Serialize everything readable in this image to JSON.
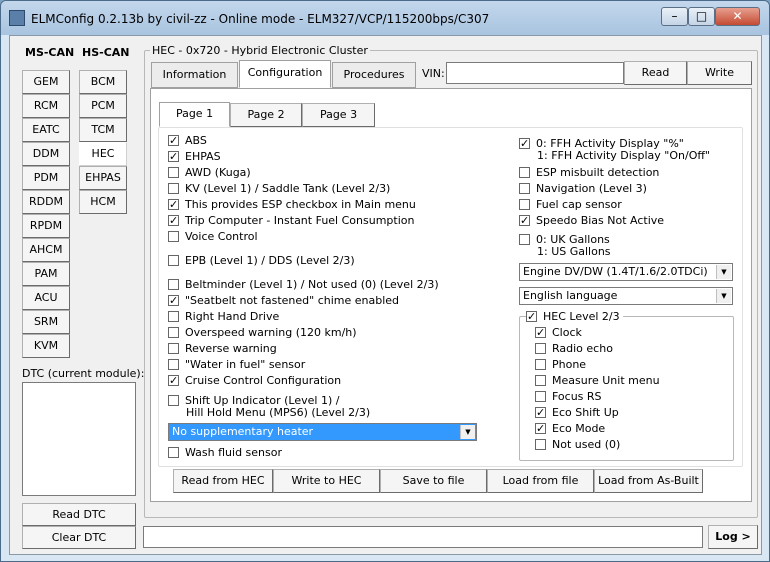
{
  "window": {
    "title": "ELMConfig 0.2.13b by civil-zz - Online mode - ELM327/VCP/115200bps/C307",
    "min_glyph": "–",
    "max_glyph": "□",
    "close_glyph": "✕"
  },
  "bus": {
    "ms_can_label": "MS-CAN",
    "hs_can_label": "HS-CAN",
    "ms_can": [
      "GEM",
      "RCM",
      "EATC",
      "DDM",
      "PDM",
      "RDDM",
      "RPDM",
      "AHCM",
      "PAM",
      "ACU",
      "SRM",
      "KVM"
    ],
    "hs_can": [
      "BCM",
      "PCM",
      "TCM",
      "HEC",
      "EHPAS",
      "HCM"
    ],
    "hs_active": "HEC"
  },
  "dtc": {
    "label": "DTC (current module):",
    "read": "Read DTC",
    "clear": "Clear DTC"
  },
  "module": {
    "group_label": "HEC - 0x720 - Hybrid Electronic Cluster",
    "tabs": [
      "Information",
      "Configuration",
      "Procedures"
    ],
    "active_tab": "Configuration",
    "vin_label": "VIN:",
    "vin_value": "",
    "read": "Read",
    "write": "Write"
  },
  "pages": [
    "Page 1",
    "Page 2",
    "Page 3"
  ],
  "active_page": "Page 1",
  "left_options": [
    {
      "label": "ABS",
      "checked": true
    },
    {
      "label": "EHPAS",
      "checked": true
    },
    {
      "label": "AWD (Kuga)",
      "checked": false
    },
    {
      "label": "KV (Level 1) / Saddle Tank (Level 2/3)",
      "checked": false
    },
    {
      "label": "This provides ESP checkbox in Main menu",
      "checked": true
    },
    {
      "label": "Trip Computer - Instant Fuel Consumption",
      "checked": true
    },
    {
      "label": "Voice Control",
      "checked": false
    },
    {
      "label": "EPB (Level 1) / DDS (Level 2/3)",
      "checked": false
    },
    {
      "label": "Beltminder (Level 1) / Not used (0) (Level 2/3)",
      "checked": false
    },
    {
      "label": "\"Seatbelt not fastened\" chime enabled",
      "checked": true
    },
    {
      "label": "Right Hand Drive",
      "checked": false
    },
    {
      "label": "Overspeed warning (120 km/h)",
      "checked": false
    },
    {
      "label": "Reverse warning",
      "checked": false
    },
    {
      "label": "\"Water in fuel\" sensor",
      "checked": false
    },
    {
      "label": "Cruise Control Configuration",
      "checked": true
    },
    {
      "label": "Shift Up Indicator (Level 1) /",
      "label2": "Hill Hold Menu (MPS6) (Level 2/3)",
      "checked": false
    },
    {
      "label": "Wash fluid sensor",
      "checked": false
    }
  ],
  "heater_select": "No supplementary heater",
  "right_options": [
    {
      "label": "0: FFH Activity Display \"%\"",
      "label2": "1: FFH Activity Display \"On/Off\"",
      "checked": true
    },
    {
      "label": "ESP misbuilt detection",
      "checked": false
    },
    {
      "label": "Navigation (Level 3)",
      "checked": false
    },
    {
      "label": "Fuel cap sensor",
      "checked": false
    },
    {
      "label": "Speedo Bias Not Active",
      "checked": true
    },
    {
      "label": "0: UK Gallons",
      "label2": "1: US Gallons",
      "checked": false
    }
  ],
  "engine_select": "Engine DV/DW (1.4T/1.6/2.0TDCi)",
  "language_select": "English language",
  "hec_level": {
    "label": "HEC Level 2/3",
    "checked": true,
    "items": [
      {
        "label": "Clock",
        "checked": true
      },
      {
        "label": "Radio echo",
        "checked": false
      },
      {
        "label": "Phone",
        "checked": false
      },
      {
        "label": "Measure Unit menu",
        "checked": false
      },
      {
        "label": "Focus RS",
        "checked": false
      },
      {
        "label": "Eco Shift Up",
        "checked": true
      },
      {
        "label": "Eco Mode",
        "checked": true
      },
      {
        "label": "Not used (0)",
        "checked": false
      }
    ]
  },
  "actions": [
    "Read from HEC",
    "Write to HEC",
    "Save to file",
    "Load from file",
    "Load from As-Built"
  ],
  "log_button": "Log >"
}
